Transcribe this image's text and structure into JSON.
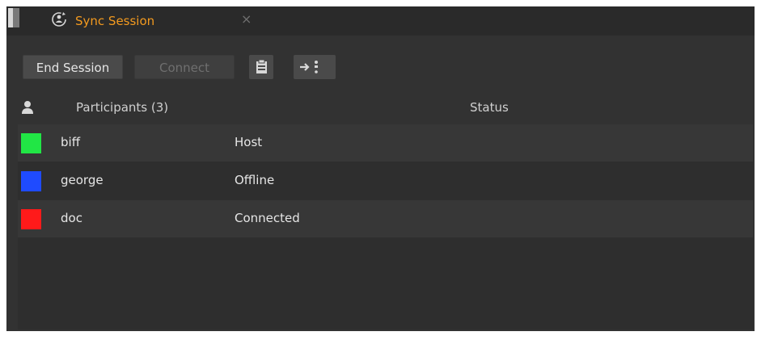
{
  "tab": {
    "title": "Sync Session",
    "icon": "sync-session-icon",
    "close_glyph": "×",
    "title_color": "#f39a1f"
  },
  "toolbar": {
    "end_session_label": "End Session",
    "connect_label": "Connect",
    "clipboard_icon": "clipboard-icon",
    "follow_icon": "follow-participant-icon"
  },
  "table": {
    "participants_header": "Participants (3)",
    "status_header": "Status",
    "rows": [
      {
        "name": "biff",
        "status": "Host",
        "color": "#21e645"
      },
      {
        "name": "george",
        "status": "Offline",
        "color": "#1f4bff"
      },
      {
        "name": "doc",
        "status": "Connected",
        "color": "#ff1a1a"
      }
    ]
  }
}
